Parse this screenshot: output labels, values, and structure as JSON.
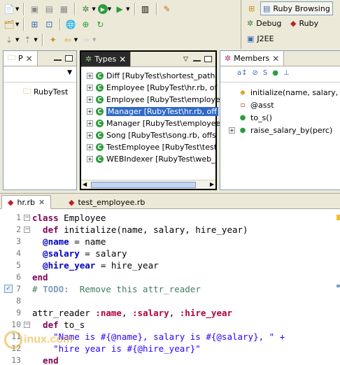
{
  "perspectives": {
    "ruby_browsing": "Ruby Browsing",
    "debug": "Debug",
    "ruby": "Ruby",
    "j2ee": "J2EE"
  },
  "navigator_panel": {
    "tab_label": "P",
    "items": [
      "RubyTest"
    ]
  },
  "types_panel": {
    "tab_label": "Types",
    "items": [
      {
        "label": "Diff [RubyTest\\shortest_path",
        "selected": false
      },
      {
        "label": "Employee [RubyTest\\hr.rb, of",
        "selected": false
      },
      {
        "label": "Employee [RubyTest\\employe",
        "selected": false
      },
      {
        "label": "Manager [RubyTest\\hr.rb, off",
        "selected": true
      },
      {
        "label": "Manager [RubyTest\\employee",
        "selected": false
      },
      {
        "label": "Song [RubyTest\\song.rb, offs",
        "selected": false
      },
      {
        "label": "TestEmployee [RubyTest\\test",
        "selected": false
      },
      {
        "label": "WEBIndexer [RubyTest\\web_",
        "selected": false
      }
    ]
  },
  "members_panel": {
    "tab_label": "Members",
    "items": [
      {
        "label": "initialize(name, salary, h",
        "icon": "constructor-icon"
      },
      {
        "label": "@asst",
        "icon": "field-icon"
      },
      {
        "label": "to_s()",
        "icon": "method-icon"
      },
      {
        "label": "raise_salary_by(perc)",
        "icon": "method-icon"
      }
    ]
  },
  "editor": {
    "tabs": [
      "hr.rb",
      "test_employee.rb"
    ],
    "line_numbers": [
      "1",
      "2",
      "3",
      "4",
      "5",
      "6",
      "7",
      "8",
      "9",
      "10",
      "11",
      "12",
      "13"
    ],
    "code": {
      "l1_kw": "class",
      "l1_rest": " Employee",
      "l2_kw": "  def",
      "l2_rest": " initialize(name, salary, hire_year)",
      "l3_ivar": "  @name",
      "l3_rest": " = name",
      "l4_ivar": "  @salary",
      "l4_rest": " = salary",
      "l5_ivar": "  @hire_year",
      "l5_rest": " = hire_year",
      "l6_kw": "end",
      "l7_cmt": "# ",
      "l7_todo": "TODO:",
      "l7_rest": "  Remove this attr_reader",
      "l9_a": "attr_reader ",
      "l9_s1": ":name",
      "l9_c1": ", ",
      "l9_s2": ":salary",
      "l9_c2": ", ",
      "l9_s3": ":hire_year",
      "l10_kw": "  def",
      "l10_rest": " to_s",
      "l11_str": "    \"Name is #{@name}, salary is #{@salary}, \" +",
      "l12_str": "    \"hire year is #{@hire_year}\"",
      "l13_kw": "  end"
    }
  },
  "watermark": "inux.com"
}
